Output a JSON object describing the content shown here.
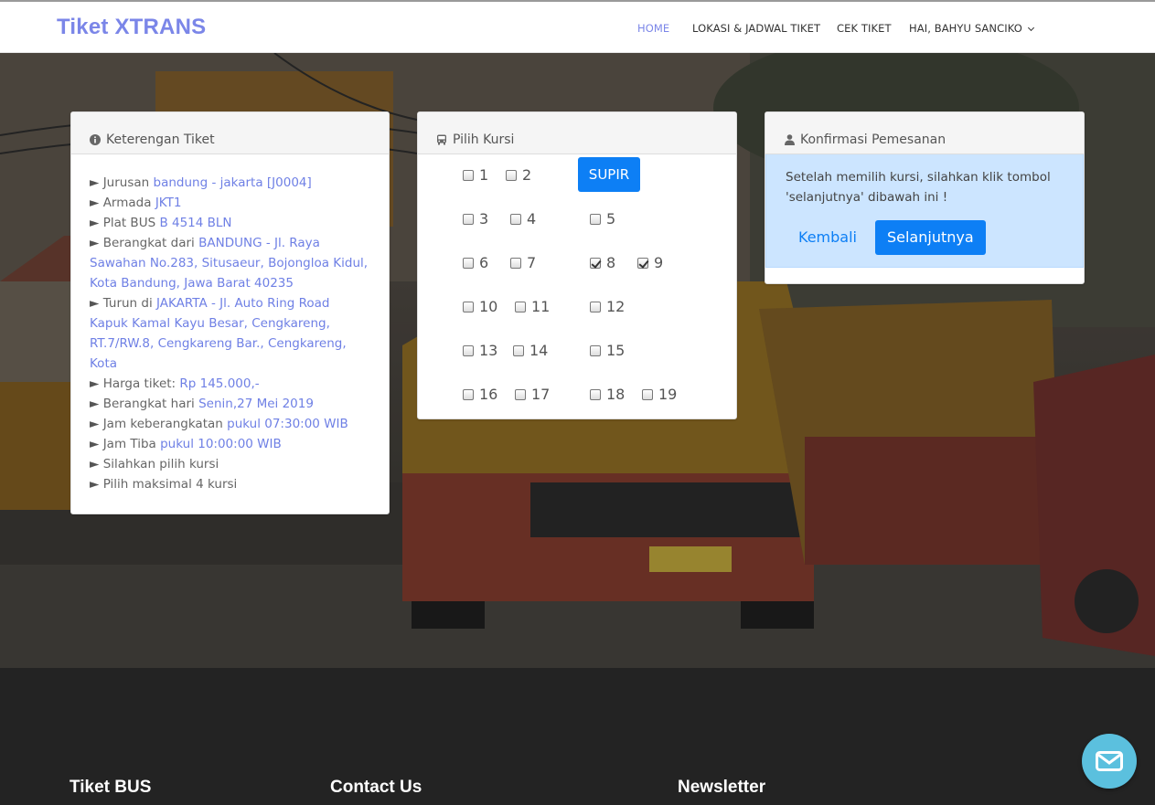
{
  "brand": "Tiket XTRANS",
  "nav": {
    "items": [
      {
        "label": "HOME",
        "active": true
      },
      {
        "label": "LOKASI & JADWAL TIKET",
        "active": false
      },
      {
        "label": "CEK TIKET",
        "active": false
      },
      {
        "label": "HAI, BAHYU SANCIKO",
        "active": false
      }
    ]
  },
  "info_panel": {
    "title": "Keterengan Tiket",
    "rows": [
      {
        "label": "Jurusan",
        "value": "bandung - jakarta [J0004]"
      },
      {
        "label": "Armada",
        "value": "JKT1"
      },
      {
        "label": "Plat BUS",
        "value": "B 4514 BLN"
      },
      {
        "label": "Berangkat dari",
        "value": "BANDUNG - Jl. Raya Sawahan No.283, Situsaeur, Bojongloa Kidul, Kota Bandung, Jawa Barat 40235"
      },
      {
        "label": "Turun di",
        "value": "JAKARTA - Jl. Auto Ring Road Kapuk Kamal Kayu Besar, Cengkareng, RT.7/RW.8, Cengkareng Bar., Cengkareng, Kota"
      },
      {
        "label": "Harga tiket:",
        "value": "Rp 145.000,-"
      },
      {
        "label": "Berangkat hari",
        "value": "Senin,27 Mei 2019"
      },
      {
        "label": "Jam keberangkatan",
        "value": "pukul 07:30:00 WIB"
      },
      {
        "label": "Jam Tiba",
        "value": "pukul 10:00:00 WIB"
      },
      {
        "label": "Silahkan pilih kursi",
        "value": ""
      },
      {
        "label": "Pilih maksimal 4 kursi",
        "value": ""
      }
    ]
  },
  "seat_panel": {
    "title": "Pilih Kursi",
    "driver_label": "SUPIR",
    "seats": [
      {
        "number": "1",
        "checked": false
      },
      {
        "number": "2",
        "checked": false
      },
      {
        "number": "3",
        "checked": false
      },
      {
        "number": "4",
        "checked": false
      },
      {
        "number": "5",
        "checked": false
      },
      {
        "number": "6",
        "checked": false
      },
      {
        "number": "7",
        "checked": false
      },
      {
        "number": "8",
        "checked": true
      },
      {
        "number": "9",
        "checked": true
      },
      {
        "number": "10",
        "checked": false
      },
      {
        "number": "11",
        "checked": false
      },
      {
        "number": "12",
        "checked": false
      },
      {
        "number": "13",
        "checked": false
      },
      {
        "number": "14",
        "checked": false
      },
      {
        "number": "15",
        "checked": false
      },
      {
        "number": "16",
        "checked": false
      },
      {
        "number": "17",
        "checked": false
      },
      {
        "number": "18",
        "checked": false
      },
      {
        "number": "19",
        "checked": false
      }
    ]
  },
  "confirm_panel": {
    "title": "Konfirmasi Pemesanan",
    "message": "Setelah memilih kursi, silahkan klik tombol 'selanjutnya' dibawah ini !",
    "back_label": "Kembali",
    "next_label": "Selanjutnya"
  },
  "footer": {
    "col1_title": "Tiket BUS",
    "col2_title": "Contact Us",
    "col3_title": "Newsletter"
  },
  "colors": {
    "brand": "#7b86e8",
    "primary": "#0d7ff5",
    "value_link": "#6f80e5",
    "alert_bg": "#cce5ff",
    "footer_bg": "#232323",
    "chat_button": "#5bc0de"
  }
}
